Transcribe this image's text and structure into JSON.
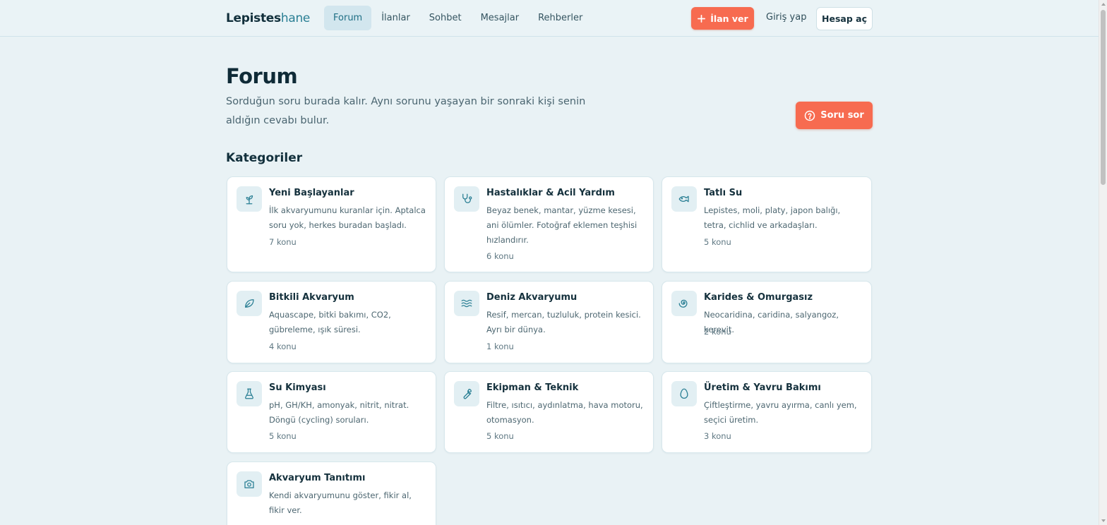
{
  "brand": {
    "part1": "Lepistes",
    "part2": "hane"
  },
  "nav": [
    "Forum",
    "İlanlar",
    "Sohbet",
    "Mesajlar",
    "Rehberler"
  ],
  "header": {
    "post_ad": "İlan ver",
    "login": "Giriş yap",
    "signup": "Hesap aç"
  },
  "page": {
    "title": "Forum",
    "description": "Sorduğun soru burada kalır. Aynı sorunu yaşayan bir sonraki kişi senin aldığın cevabı bulur.",
    "ask_button": "Soru sor",
    "categories_heading": "Kategoriler"
  },
  "categories": [
    {
      "title": "Yeni Başlayanlar",
      "desc": "İlk akvaryumunu kuranlar için. Aptalca soru yok, herkes buradan başladı.",
      "count": "7 konu",
      "icon": "sprout-icon"
    },
    {
      "title": "Hastalıklar & Acil Yardım",
      "desc": "Beyaz benek, mantar, yüzme kesesi, ani ölümler. Fotoğraf eklemen teşhisi hızlandırır.",
      "count": "6 konu",
      "icon": "stethoscope-icon"
    },
    {
      "title": "Tatlı Su",
      "desc": "Lepistes, moli, platy, japon balığı, tetra, cichlid ve arkadaşları.",
      "count": "5 konu",
      "icon": "fish-icon"
    },
    {
      "title": "Bitkili Akvaryum",
      "desc": "Aquascape, bitki bakımı, CO2, gübreleme, ışık süresi.",
      "count": "4 konu",
      "icon": "leaf-icon"
    },
    {
      "title": "Deniz Akvaryumu",
      "desc": "Resif, mercan, tuzluluk, protein kesici. Ayrı bir dünya.",
      "count": "1 konu",
      "icon": "waves-icon"
    },
    {
      "title": "Karides & Omurgasız",
      "desc": "Neocaridina, caridina, salyangoz, kerevit.",
      "count": "2 konu",
      "icon": "shell-icon"
    },
    {
      "title": "Su Kimyası",
      "desc": "pH, GH/KH, amonyak, nitrit, nitrat. Döngü (cycling) soruları.",
      "count": "5 konu",
      "icon": "flask-icon"
    },
    {
      "title": "Ekipman & Teknik",
      "desc": "Filtre, ısıtıcı, aydınlatma, hava motoru, otomasyon.",
      "count": "5 konu",
      "icon": "wrench-icon"
    },
    {
      "title": "Üretim & Yavru Bakımı",
      "desc": "Çiftleştirme, yavru ayırma, canlı yem, seçici üretim.",
      "count": "3 konu",
      "icon": "egg-icon"
    },
    {
      "title": "Akvaryum Tanıtımı",
      "desc": "Kendi akvaryumunu göster, fikir al, fikir ver.",
      "count": "",
      "icon": "camera-icon"
    }
  ]
}
